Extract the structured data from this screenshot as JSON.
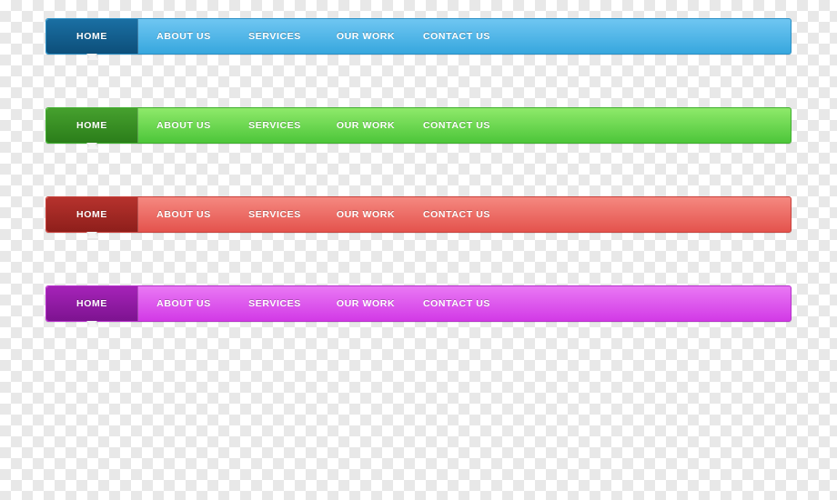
{
  "navs": [
    {
      "id": "blue",
      "colors": {
        "base": "#37a7de",
        "active": "#0d4f7a"
      },
      "items": [
        {
          "label": "HOME",
          "active": true
        },
        {
          "label": "ABOUT US",
          "active": false
        },
        {
          "label": "SERVICES",
          "active": false
        },
        {
          "label": "OUR WORK",
          "active": false
        },
        {
          "label": "CONTACT US",
          "active": false
        }
      ]
    },
    {
      "id": "green",
      "colors": {
        "base": "#4dc63a",
        "active": "#2b7e1a"
      },
      "items": [
        {
          "label": "HOME",
          "active": true
        },
        {
          "label": "ABOUT US",
          "active": false
        },
        {
          "label": "SERVICES",
          "active": false
        },
        {
          "label": "OUR WORK",
          "active": false
        },
        {
          "label": "CONTACT US",
          "active": false
        }
      ]
    },
    {
      "id": "red",
      "colors": {
        "base": "#e4534d",
        "active": "#8e1f1b"
      },
      "items": [
        {
          "label": "HOME",
          "active": true
        },
        {
          "label": "ABOUT US",
          "active": false
        },
        {
          "label": "SERVICES",
          "active": false
        },
        {
          "label": "OUR WORK",
          "active": false
        },
        {
          "label": "CONTACT US",
          "active": false
        }
      ]
    },
    {
      "id": "magenta",
      "colors": {
        "base": "#d23ae6",
        "active": "#7d1390"
      },
      "items": [
        {
          "label": "HOME",
          "active": true
        },
        {
          "label": "ABOUT US",
          "active": false
        },
        {
          "label": "SERVICES",
          "active": false
        },
        {
          "label": "OUR WORK",
          "active": false
        },
        {
          "label": "CONTACT US",
          "active": false
        }
      ]
    }
  ]
}
